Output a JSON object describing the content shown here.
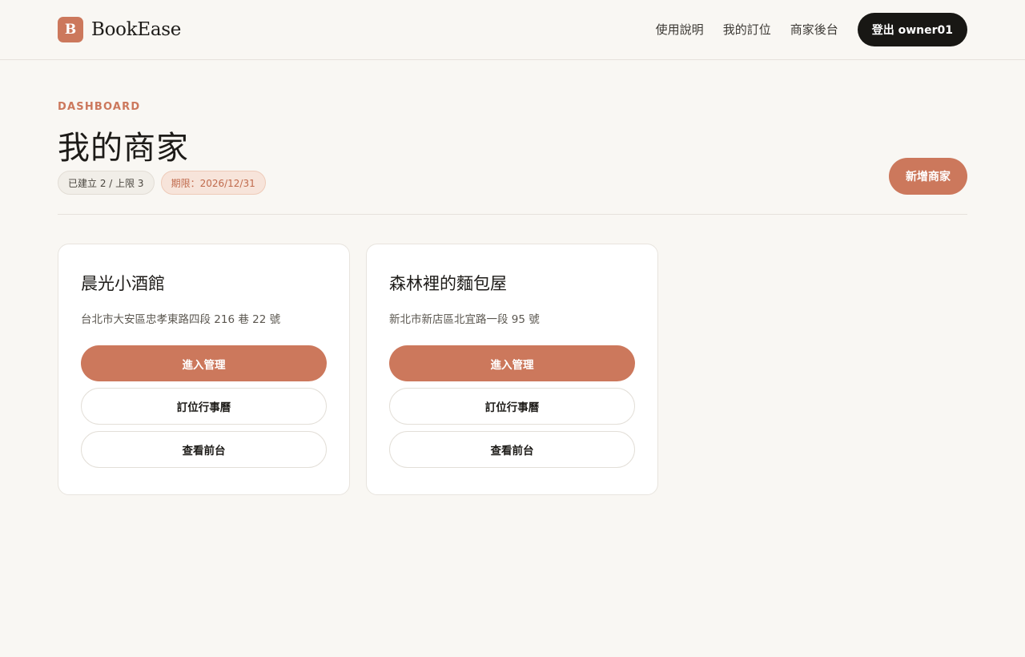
{
  "brand": {
    "logo_letter": "B",
    "name": "BookEase"
  },
  "nav": {
    "links": [
      "使用說明",
      "我的訂位",
      "商家後台"
    ],
    "logout_label": "登出 owner01"
  },
  "header": {
    "eyebrow": "DASHBOARD",
    "title": "我的商家",
    "count_badge": "已建立 2 / 上限 3",
    "expiry_badge": "期限：2026/12/31",
    "add_button": "新增商家"
  },
  "businesses": [
    {
      "name": "晨光小酒館",
      "address": "台北市大安區忠孝東路四段 216 巷 22 號",
      "manage_label": "進入管理",
      "calendar_label": "訂位行事曆",
      "frontend_label": "查看前台"
    },
    {
      "name": "森林裡的麵包屋",
      "address": "新北市新店區北宜路一段 95 號",
      "manage_label": "進入管理",
      "calendar_label": "訂位行事曆",
      "frontend_label": "查看前台"
    }
  ],
  "colors": {
    "accent": "#cc785c",
    "dark": "#181714",
    "background": "#f9f7f3"
  }
}
